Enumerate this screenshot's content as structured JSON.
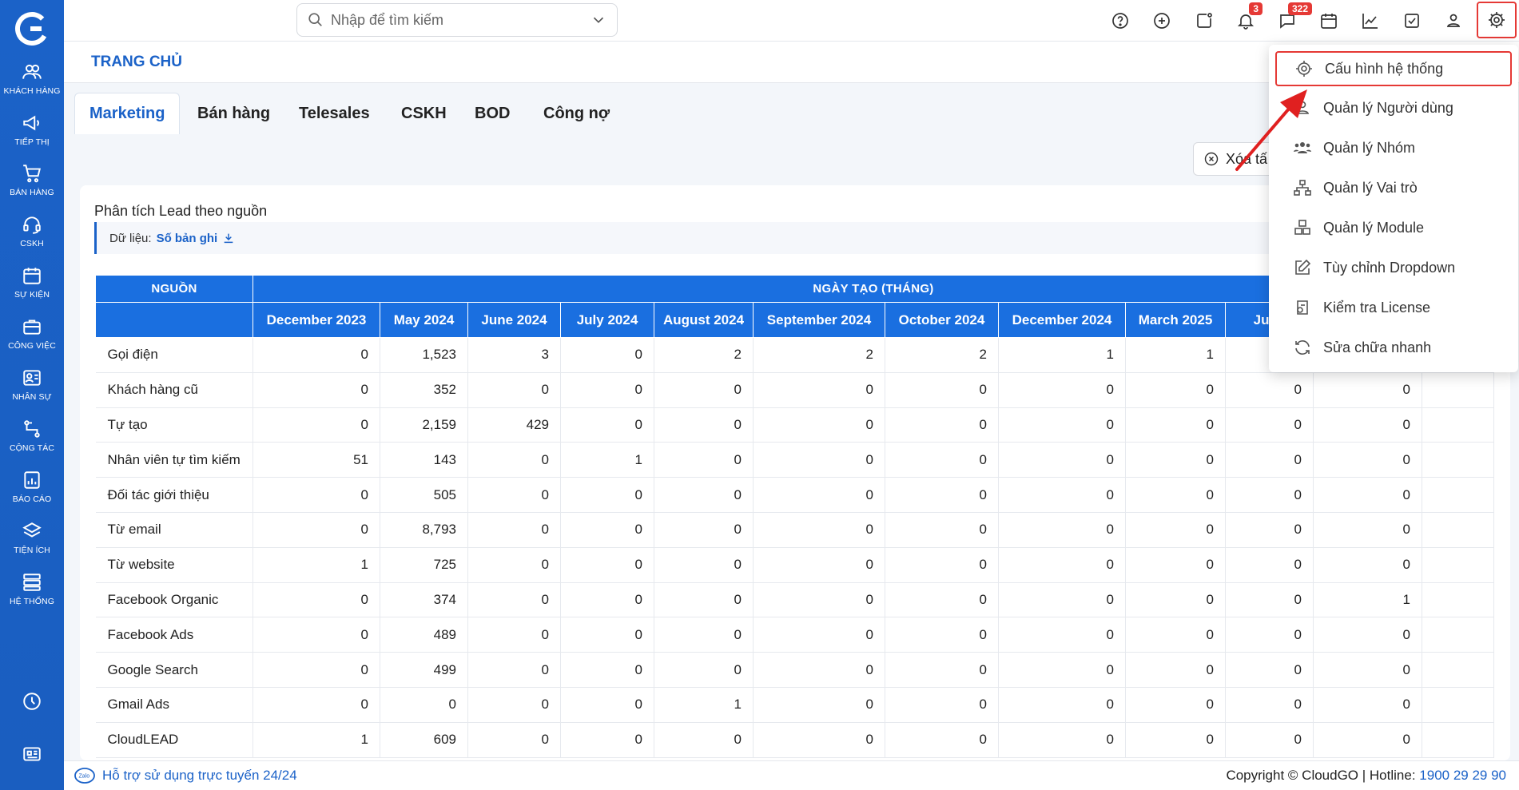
{
  "search": {
    "placeholder": "Nhập để tìm kiếm"
  },
  "sidebar": {
    "items": [
      {
        "label": "KHÁCH HÀNG"
      },
      {
        "label": "TIẾP THỊ"
      },
      {
        "label": "BÁN HÀNG"
      },
      {
        "label": "CSKH"
      },
      {
        "label": "SỰ KIỆN"
      },
      {
        "label": "CÔNG VIỆC"
      },
      {
        "label": "NHÂN SỰ"
      },
      {
        "label": "CỘNG TÁC"
      },
      {
        "label": "BÁO CÁO"
      },
      {
        "label": "TIỆN ÍCH"
      },
      {
        "label": "HỆ THỐNG"
      }
    ]
  },
  "topbar": {
    "badges": {
      "notifications": "3",
      "messages": "322"
    }
  },
  "page": {
    "title": "TRANG CHỦ"
  },
  "tabs": [
    "Marketing",
    "Bán hàng",
    "Telesales",
    "CSKH",
    "BOD",
    "Công nợ"
  ],
  "clear_button": "Xóa tấ",
  "card": {
    "title": "Phân tích Lead theo nguồn",
    "data_label": "Dữ liệu:",
    "records_link": "Số bản ghi"
  },
  "table": {
    "source_header": "NGUỒN",
    "group_header": "NGÀY TẠO (THÁNG)",
    "months": [
      "December 2023",
      "May 2024",
      "June 2024",
      "July 2024",
      "August 2024",
      "September 2024",
      "October 2024",
      "December 2024",
      "March 2025",
      "June",
      "",
      ""
    ],
    "rows": [
      {
        "source": "Gọi điện",
        "values": [
          "0",
          "1,523",
          "3",
          "0",
          "2",
          "2",
          "2",
          "1",
          "1",
          "",
          "",
          ""
        ]
      },
      {
        "source": "Khách hàng cũ",
        "values": [
          "0",
          "352",
          "0",
          "0",
          "0",
          "0",
          "0",
          "0",
          "0",
          "0",
          "0",
          ""
        ]
      },
      {
        "source": "Tự tạo",
        "values": [
          "0",
          "2,159",
          "429",
          "0",
          "0",
          "0",
          "0",
          "0",
          "0",
          "0",
          "0",
          ""
        ]
      },
      {
        "source": "Nhân viên tự tìm kiếm",
        "values": [
          "51",
          "143",
          "0",
          "1",
          "0",
          "0",
          "0",
          "0",
          "0",
          "0",
          "0",
          ""
        ]
      },
      {
        "source": "Đối tác giới thiệu",
        "values": [
          "0",
          "505",
          "0",
          "0",
          "0",
          "0",
          "0",
          "0",
          "0",
          "0",
          "0",
          ""
        ]
      },
      {
        "source": "Từ email",
        "values": [
          "0",
          "8,793",
          "0",
          "0",
          "0",
          "0",
          "0",
          "0",
          "0",
          "0",
          "0",
          ""
        ]
      },
      {
        "source": "Từ website",
        "values": [
          "1",
          "725",
          "0",
          "0",
          "0",
          "0",
          "0",
          "0",
          "0",
          "0",
          "0",
          ""
        ]
      },
      {
        "source": "Facebook Organic",
        "values": [
          "0",
          "374",
          "0",
          "0",
          "0",
          "0",
          "0",
          "0",
          "0",
          "0",
          "1",
          ""
        ]
      },
      {
        "source": "Facebook Ads",
        "values": [
          "0",
          "489",
          "0",
          "0",
          "0",
          "0",
          "0",
          "0",
          "0",
          "0",
          "0",
          ""
        ]
      },
      {
        "source": "Google Search",
        "values": [
          "0",
          "499",
          "0",
          "0",
          "0",
          "0",
          "0",
          "0",
          "0",
          "0",
          "0",
          ""
        ]
      },
      {
        "source": "Gmail Ads",
        "values": [
          "0",
          "0",
          "0",
          "0",
          "1",
          "0",
          "0",
          "0",
          "0",
          "0",
          "0",
          ""
        ]
      },
      {
        "source": "CloudLEAD",
        "values": [
          "1",
          "609",
          "0",
          "0",
          "0",
          "0",
          "0",
          "0",
          "0",
          "0",
          "0",
          ""
        ]
      }
    ]
  },
  "settings_menu": {
    "items": [
      {
        "label": "Cấu hình hệ thống",
        "icon": "gear-icon"
      },
      {
        "label": "Quản lý Người dùng",
        "icon": "user-icon"
      },
      {
        "label": "Quản lý Nhóm",
        "icon": "group-icon"
      },
      {
        "label": "Quản lý Vai trò",
        "icon": "hierarchy-icon"
      },
      {
        "label": "Quản lý Module",
        "icon": "modules-icon"
      },
      {
        "label": "Tùy chỉnh Dropdown",
        "icon": "edit-icon"
      },
      {
        "label": "Kiểm tra License",
        "icon": "license-icon"
      },
      {
        "label": "Sửa chữa nhanh",
        "icon": "refresh-icon"
      }
    ]
  },
  "footer": {
    "support": "Hỗ trợ sử dụng trực tuyến 24/24",
    "copyright": "Copyright © CloudGO",
    "hotline_label": "Hotline:",
    "hotline": "1900 29 29 90",
    "zalo_label": "Zalo"
  },
  "colors": {
    "primary": "#1b62c8",
    "header_blue": "#1a6fe0",
    "badge_red": "#e53935",
    "highlight_red": "#e53935"
  }
}
